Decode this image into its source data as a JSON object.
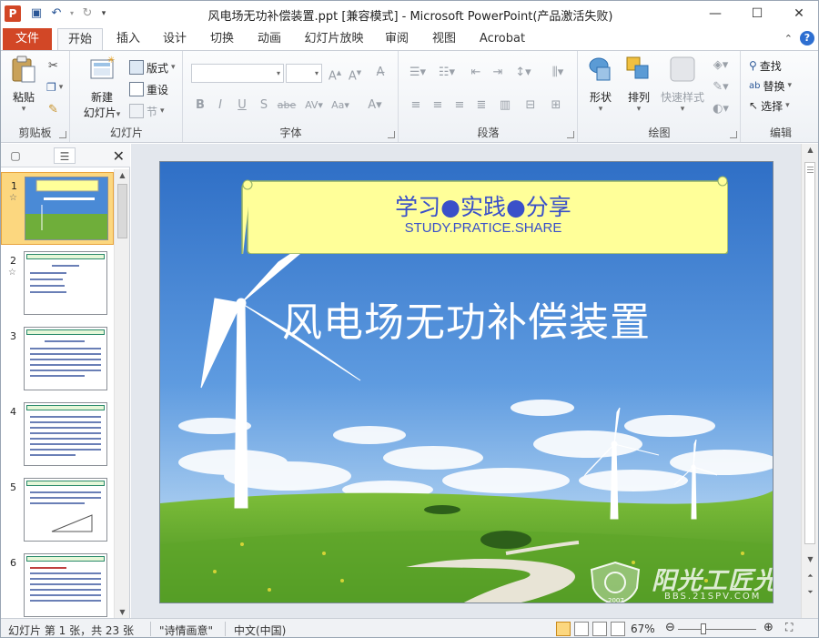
{
  "window": {
    "title": "风电场无功补偿装置.ppt [兼容模式] - Microsoft PowerPoint(产品激活失败)",
    "app_icon_letter": "P"
  },
  "qat": {
    "save_icon": "save-icon",
    "undo_icon": "undo-icon",
    "redo_icon": "redo-icon"
  },
  "tabs": {
    "file": "文件",
    "items": [
      "开始",
      "插入",
      "设计",
      "切换",
      "动画",
      "幻灯片放映",
      "审阅",
      "视图",
      "Acrobat"
    ],
    "active": "开始"
  },
  "ribbon": {
    "clipboard": {
      "label": "剪贴板",
      "paste": "粘贴"
    },
    "slides": {
      "label": "幻灯片",
      "new_slide_1": "新建",
      "new_slide_2": "幻灯片",
      "layout": "版式",
      "reset": "重设",
      "section": "节"
    },
    "font": {
      "label": "字体",
      "font_name": "",
      "font_size": ""
    },
    "paragraph": {
      "label": "段落"
    },
    "drawing": {
      "label": "绘图",
      "shapes": "形状",
      "arrange": "排列",
      "quick_styles": "快速样式"
    },
    "editing": {
      "label": "编辑",
      "find": "查找",
      "replace": "替换",
      "select": "选择"
    }
  },
  "slide_panel": {
    "selected": 1,
    "thumbnails": [
      {
        "num": "1",
        "star": "☆"
      },
      {
        "num": "2",
        "star": "☆"
      },
      {
        "num": "3",
        "star": ""
      },
      {
        "num": "4",
        "star": ""
      },
      {
        "num": "5",
        "star": ""
      },
      {
        "num": "6",
        "star": ""
      }
    ]
  },
  "slide": {
    "banner_title": "学习●实践●分享",
    "banner_subtitle": "STUDY.PRATICE.SHARE",
    "title": "风电场无功补偿装置",
    "watermark_text": "阳光工匠光伏论坛",
    "watermark_url": "BBS.21SPV.COM",
    "watermark_year": "2007"
  },
  "status": {
    "slide_info": "幻灯片 第 1 张，共 23 张",
    "theme": "\"诗情画意\"",
    "language": "中文(中国)",
    "zoom": "67%"
  },
  "colors": {
    "accent": "#d24726",
    "selected_thumb": "#fcd77f",
    "banner_fill": "#ffff99",
    "banner_text": "#3a50c9"
  }
}
